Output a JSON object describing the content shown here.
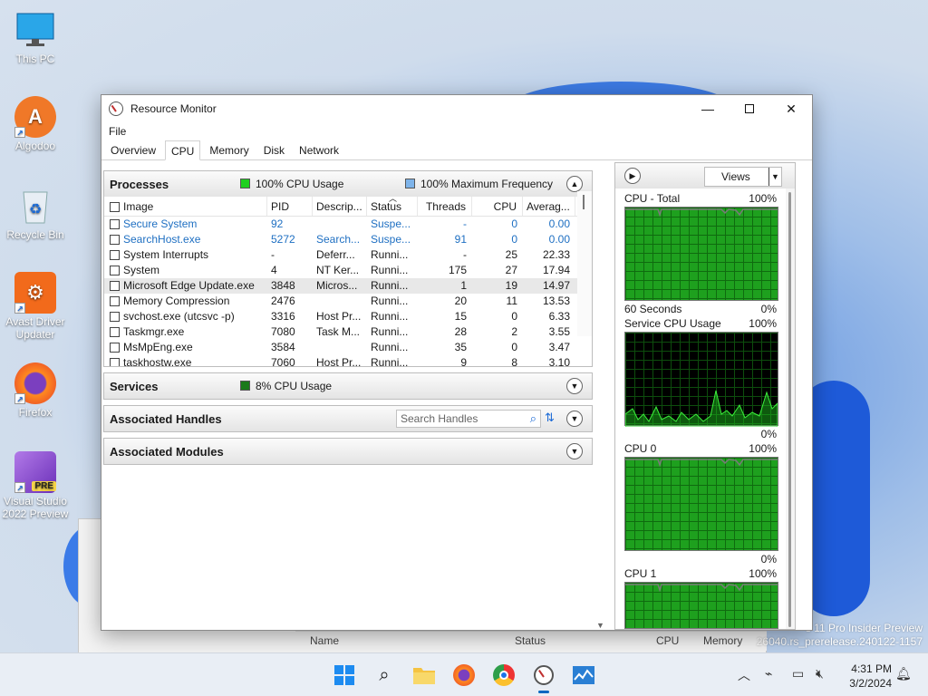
{
  "desktop": {
    "icons": [
      {
        "label": "This PC",
        "icon": "monitor-icon"
      },
      {
        "label": "Algodoo",
        "icon": "algodoo-icon"
      },
      {
        "label": "Recycle Bin",
        "icon": "recycle-bin-icon"
      },
      {
        "label": "Avast Driver Updater",
        "icon": "avast-icon"
      },
      {
        "label": "Firefox",
        "icon": "firefox-icon"
      },
      {
        "label": "Visual Studio 2022 Preview",
        "icon": "visual-studio-icon",
        "badge": "PRE"
      }
    ],
    "watermark": [
      "s 11 Pro Insider Preview",
      "26040.rs_prerelease.240122-1157"
    ]
  },
  "behind_window": {
    "columns": [
      "Name",
      "Status",
      "CPU",
      "Memory"
    ]
  },
  "window": {
    "title": "Resource Monitor",
    "menu": [
      "File"
    ],
    "tabs": [
      "Overview",
      "CPU",
      "Memory",
      "Disk",
      "Network"
    ],
    "active_tab": "CPU"
  },
  "processes": {
    "title": "Processes",
    "cpu_usage": "100% CPU Usage",
    "max_freq": "100% Maximum Frequency",
    "columns": [
      "Image",
      "PID",
      "Descrip...",
      "Status",
      "Threads",
      "CPU",
      "Averag..."
    ],
    "rows": [
      {
        "image": "Secure System",
        "pid": "92",
        "desc": "",
        "status": "Suspe...",
        "threads": "-",
        "cpu": "0",
        "avg": "0.00",
        "style": "blue"
      },
      {
        "image": "SearchHost.exe",
        "pid": "5272",
        "desc": "Search...",
        "status": "Suspe...",
        "threads": "91",
        "cpu": "0",
        "avg": "0.00",
        "style": "blue"
      },
      {
        "image": "System Interrupts",
        "pid": "-",
        "desc": "Deferr...",
        "status": "Runni...",
        "threads": "-",
        "cpu": "25",
        "avg": "22.33",
        "style": ""
      },
      {
        "image": "System",
        "pid": "4",
        "desc": "NT Ker...",
        "status": "Runni...",
        "threads": "175",
        "cpu": "27",
        "avg": "17.94",
        "style": ""
      },
      {
        "image": "Microsoft Edge Update.exe",
        "pid": "3848",
        "desc": "Micros...",
        "status": "Runni...",
        "threads": "1",
        "cpu": "19",
        "avg": "14.97",
        "style": "sel"
      },
      {
        "image": "Memory Compression",
        "pid": "2476",
        "desc": "",
        "status": "Runni...",
        "threads": "20",
        "cpu": "11",
        "avg": "13.53",
        "style": ""
      },
      {
        "image": "svchost.exe (utcsvc -p)",
        "pid": "3316",
        "desc": "Host Pr...",
        "status": "Runni...",
        "threads": "15",
        "cpu": "0",
        "avg": "6.33",
        "style": ""
      },
      {
        "image": "Taskmgr.exe",
        "pid": "7080",
        "desc": "Task M...",
        "status": "Runni...",
        "threads": "28",
        "cpu": "2",
        "avg": "3.55",
        "style": ""
      },
      {
        "image": "MsMpEng.exe",
        "pid": "3584",
        "desc": "",
        "status": "Runni...",
        "threads": "35",
        "cpu": "0",
        "avg": "3.47",
        "style": ""
      },
      {
        "image": "taskhostw.exe",
        "pid": "7060",
        "desc": "Host Pr...",
        "status": "Runni...",
        "threads": "9",
        "cpu": "8",
        "avg": "3.10",
        "style": ""
      }
    ]
  },
  "services": {
    "title": "Services",
    "cpu_usage": "8% CPU Usage"
  },
  "handles": {
    "title": "Associated Handles",
    "search_placeholder": "Search Handles"
  },
  "modules": {
    "title": "Associated Modules"
  },
  "right_pane": {
    "views_label": "Views",
    "graphs": [
      {
        "title": "CPU - Total",
        "max": "100%",
        "bottom_left": "60 Seconds",
        "min": "0%",
        "style": "green"
      },
      {
        "title": "Service CPU Usage",
        "max": "100%",
        "bottom_left": "",
        "min": "0%",
        "style": "black"
      },
      {
        "title": "CPU 0",
        "max": "100%",
        "bottom_left": "",
        "min": "0%",
        "style": "green"
      },
      {
        "title": "CPU 1",
        "max": "100%",
        "bottom_left": "",
        "min": "",
        "style": "green"
      }
    ]
  },
  "taskbar": {
    "apps": [
      "start-icon",
      "search-icon",
      "file-explorer-icon",
      "firefox-icon",
      "chrome-icon",
      "resource-monitor-icon",
      "task-manager-icon"
    ],
    "time": "4:31 PM",
    "date": "3/2/2024"
  }
}
